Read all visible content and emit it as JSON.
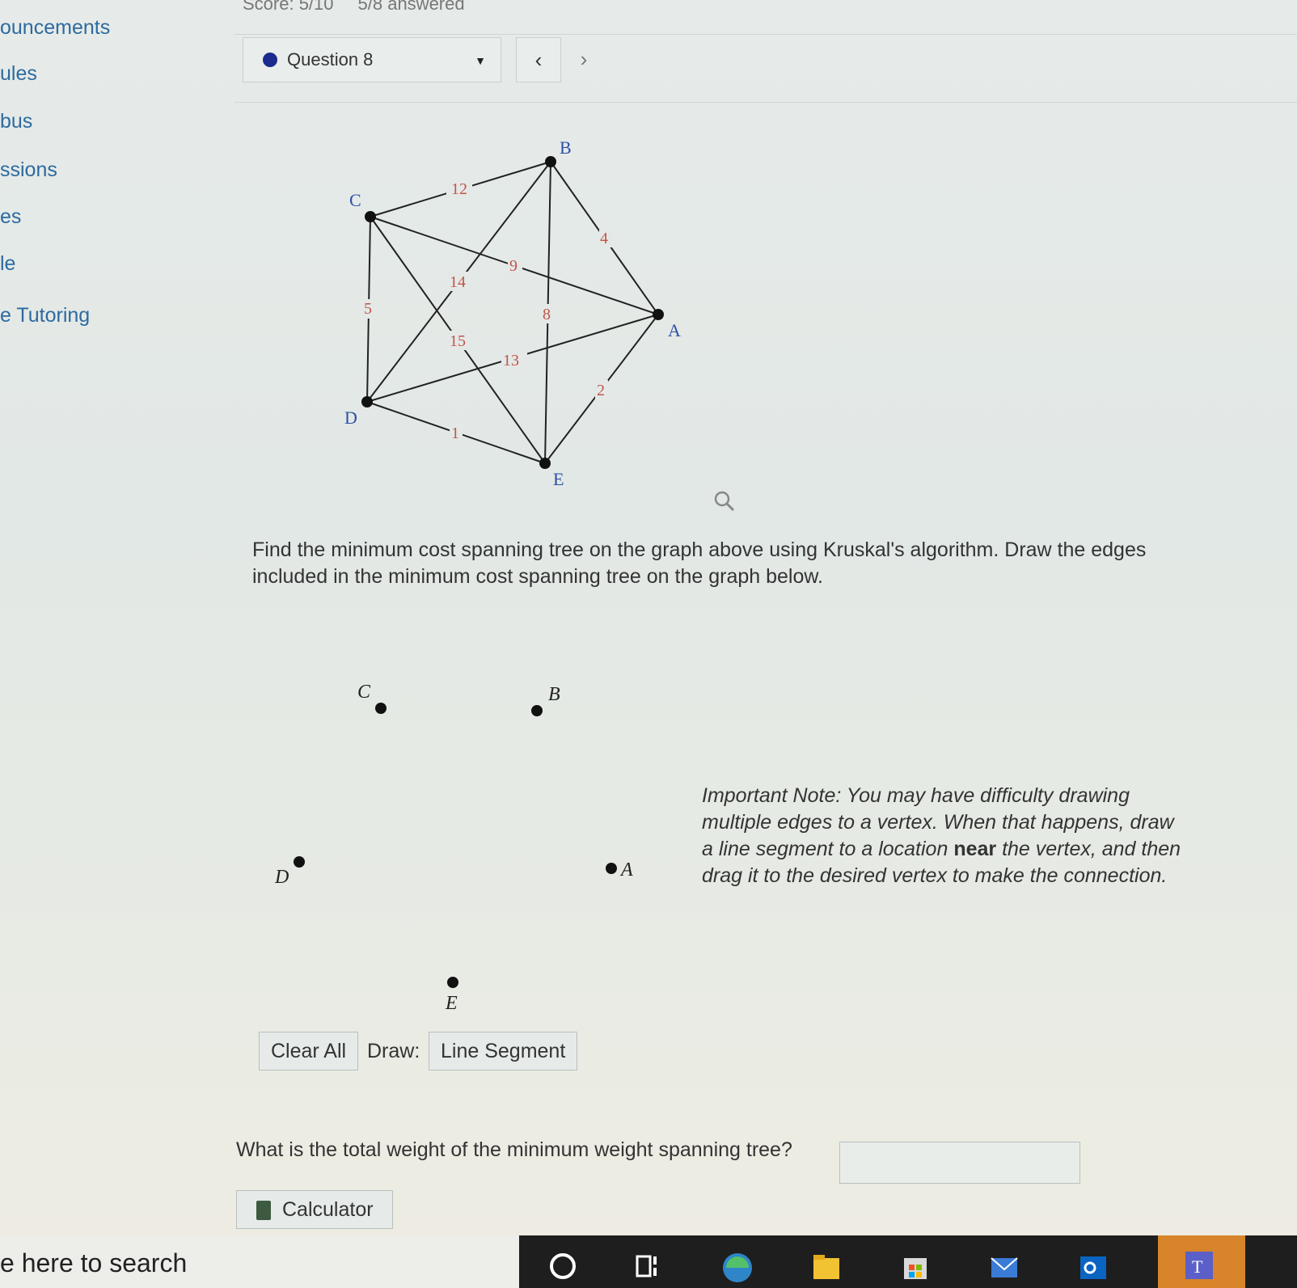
{
  "sidebar": {
    "items": [
      "ouncements",
      "ules",
      "bus",
      "ssions",
      "es",
      "le",
      "e Tutoring"
    ]
  },
  "header": {
    "score": "Score: 5/10",
    "answered": "5/8 answered"
  },
  "question_nav": {
    "selected": "Question 8",
    "prev": "‹",
    "next": "›"
  },
  "graph": {
    "vertices": [
      "A",
      "B",
      "C",
      "D",
      "E"
    ],
    "edges": [
      {
        "from": "C",
        "to": "B",
        "weight": "12"
      },
      {
        "from": "B",
        "to": "A",
        "weight": "4"
      },
      {
        "from": "C",
        "to": "A",
        "weight": "9"
      },
      {
        "from": "D",
        "to": "B",
        "weight": "14"
      },
      {
        "from": "C",
        "to": "D",
        "weight": "5"
      },
      {
        "from": "B",
        "to": "E",
        "weight": "8"
      },
      {
        "from": "C",
        "to": "E",
        "weight": "15"
      },
      {
        "from": "D",
        "to": "A",
        "weight": "13"
      },
      {
        "from": "A",
        "to": "E",
        "weight": "2"
      },
      {
        "from": "D",
        "to": "E",
        "weight": "1"
      }
    ]
  },
  "prompt": "Find the minimum cost spanning tree on the graph above using Kruskal's algorithm. Draw the edges included in the minimum cost spanning tree on the graph below.",
  "draw_area": {
    "labels": {
      "C": "C",
      "B": "B",
      "D": "D",
      "A": "A",
      "E": "E"
    }
  },
  "note": {
    "part1": "Important Note: You may have difficulty drawing multiple edges to a vertex. When that happens, draw a line segment to a location ",
    "bold": "near",
    "part2": " the vertex, and then drag it to the desired vertex to make the connection."
  },
  "controls": {
    "clear_all": "Clear All",
    "draw_label": "Draw:",
    "tool": "Line Segment"
  },
  "total_weight": {
    "question": "What is the total weight of the minimum weight spanning tree?",
    "value": ""
  },
  "calculator": "Calculator",
  "taskbar": {
    "search_text": "e here to search"
  }
}
